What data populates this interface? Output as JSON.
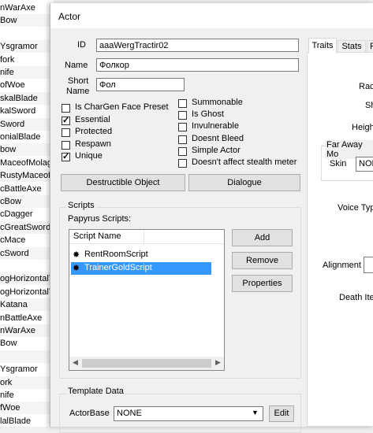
{
  "background_list": [
    "nWarAxe",
    "Bow",
    "",
    "Ysgramor",
    "fork",
    "nife",
    "ofWoe",
    "skalBlade",
    "kalSword",
    "Sword",
    "onialBlade",
    "bow",
    "MaceofMolagB",
    "RustyMaceofM",
    "cBattleAxe",
    "cBow",
    "cDagger",
    "cGreatSword",
    "cMace",
    "cSword",
    "",
    "ogHorizontalT",
    "ogHorizontalT",
    "Katana",
    "nBattleAxe",
    "nWarAxe",
    "Bow",
    "",
    "Ysgramor",
    "ork",
    "nife",
    "fWoe",
    "lalBlade"
  ],
  "dialog": {
    "title": "Actor",
    "id_label": "ID",
    "id_value": "aaaWergTractir02",
    "name_label": "Name",
    "name_value": "Фолкор",
    "short_name_label_1": "Short",
    "short_name_label_2": "Name",
    "short_name_value": "Фол"
  },
  "flags_left": [
    {
      "label": "Is CharGen Face Preset",
      "checked": false
    },
    {
      "label": "Essential",
      "checked": true
    },
    {
      "label": "Protected",
      "checked": false
    },
    {
      "label": "Respawn",
      "checked": false
    },
    {
      "label": "Unique",
      "checked": true
    }
  ],
  "flags_right": [
    {
      "label": "Summonable",
      "checked": false
    },
    {
      "label": "Is Ghost",
      "checked": false
    },
    {
      "label": "Invulnerable",
      "checked": false
    },
    {
      "label": "Doesnt Bleed",
      "checked": false
    },
    {
      "label": "Simple Actor",
      "checked": false
    },
    {
      "label": "Doesn't affect stealth meter",
      "checked": false
    }
  ],
  "buttons": {
    "destructible": "Destructible Object",
    "dialogue": "Dialogue",
    "add": "Add",
    "remove": "Remove",
    "properties": "Properties",
    "edit": "Edit"
  },
  "scripts": {
    "group_title": "Scripts",
    "papyrus_label": "Papyrus Scripts:",
    "column_header": "Script Name",
    "items": [
      {
        "name": "RentRoomScript",
        "selected": false
      },
      {
        "name": "TrainerGoldScript",
        "selected": true
      }
    ]
  },
  "template": {
    "group_title": "Template Data",
    "actorbase_label": "ActorBase",
    "actorbase_value": "NONE"
  },
  "tabs": [
    "Traits",
    "Stats",
    "Fa"
  ],
  "right_panel": {
    "race_label": "Rac",
    "sh_label": "Sh",
    "height_label": "Heigh",
    "far_away_label": "Far Away Mo",
    "skin_label": "Skin",
    "skin_value": "NON",
    "voice_label": "Voice Typ",
    "alignment_label": "Alignment",
    "death_label": "Death Ite"
  },
  "colors": {
    "selection": "#3399ff",
    "window_bg": "#f0f0f0"
  }
}
